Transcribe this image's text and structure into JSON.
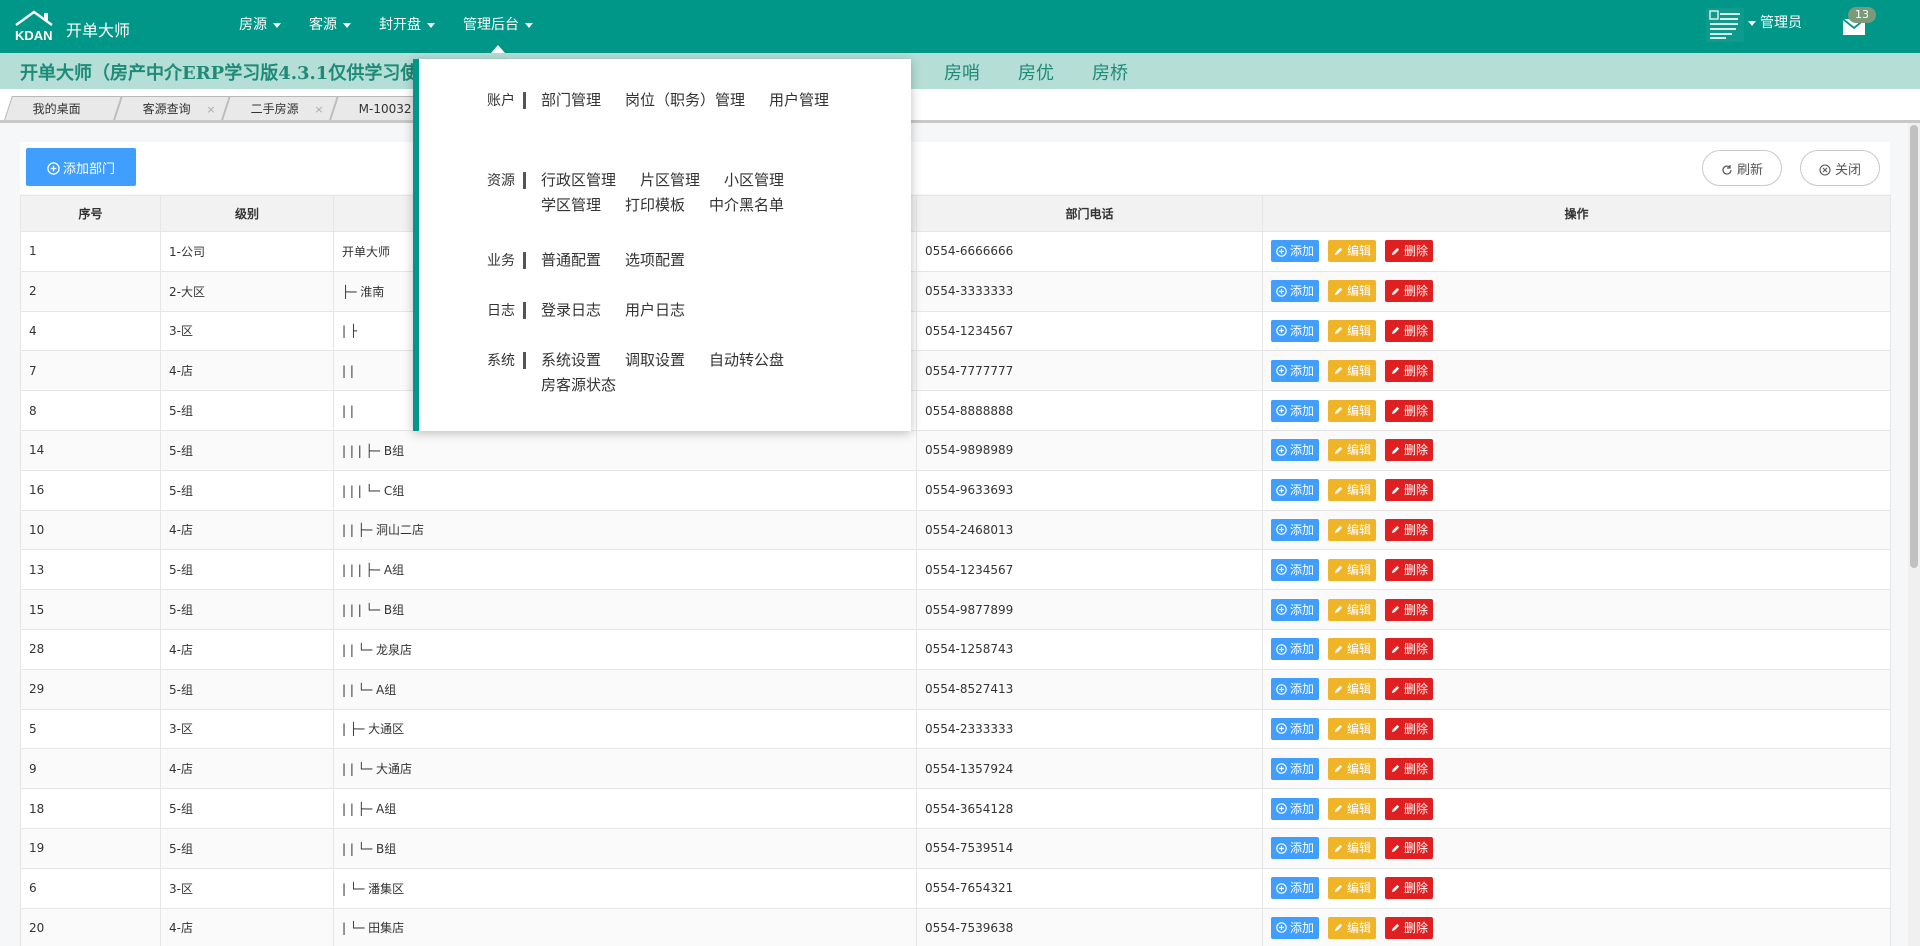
{
  "header": {
    "logo_text": "开单大师",
    "nav": [
      {
        "label": "房源"
      },
      {
        "label": "客源"
      },
      {
        "label": "封开盘"
      },
      {
        "label": "管理后台"
      }
    ],
    "user": "管理员",
    "mail_count": "13"
  },
  "banner": {
    "title": "开单大师（房产中介ERP学习版4.3.1仅供学习使用",
    "links": [
      "房哨",
      "房优",
      "房桥"
    ]
  },
  "tabs": [
    {
      "label": "我的桌面",
      "close": ""
    },
    {
      "label": "客源查询",
      "close": "×"
    },
    {
      "label": "二手房源",
      "close": "×"
    },
    {
      "label": "M-10032",
      "close": ""
    }
  ],
  "toolbar": {
    "add_dept": "添加部门",
    "refresh": "刷新",
    "close": "关闭"
  },
  "table": {
    "columns": [
      "序号",
      "级别",
      "",
      "部门电话",
      "操作"
    ],
    "actions": {
      "add": "添加",
      "edit": "编辑",
      "delete": "删除"
    },
    "rows": [
      {
        "id": "1",
        "level": "1-公司",
        "name": "开单大师",
        "phone": "0554-6666666"
      },
      {
        "id": "2",
        "level": "2-大区",
        "name": "    ├─ 淮南",
        "phone": "0554-3333333"
      },
      {
        "id": "4",
        "level": "3-区",
        "name": "    |     ├",
        "phone": "0554-1234567"
      },
      {
        "id": "7",
        "level": "4-店",
        "name": "    |     |",
        "phone": "0554-7777777"
      },
      {
        "id": "8",
        "level": "5-组",
        "name": "    |     |",
        "phone": "0554-8888888"
      },
      {
        "id": "14",
        "level": "5-组",
        "name": "    |     |      |      ├─ B组",
        "phone": "0554-9898989"
      },
      {
        "id": "16",
        "level": "5-组",
        "name": "    |     |      |      └─ C组",
        "phone": "0554-9633693"
      },
      {
        "id": "10",
        "level": "4-店",
        "name": "    |     |      ├─ 洞山二店",
        "phone": "0554-2468013"
      },
      {
        "id": "13",
        "level": "5-组",
        "name": "    |     |      |      ├─ A组",
        "phone": "0554-1234567"
      },
      {
        "id": "15",
        "level": "5-组",
        "name": "    |     |      |      └─ B组",
        "phone": "0554-9877899"
      },
      {
        "id": "28",
        "level": "4-店",
        "name": "    |     |      └─ 龙泉店",
        "phone": "0554-1258743"
      },
      {
        "id": "29",
        "level": "5-组",
        "name": "    |     |          └─ A组",
        "phone": "0554-8527413"
      },
      {
        "id": "5",
        "level": "3-区",
        "name": "    |     ├─ 大通区",
        "phone": "0554-2333333"
      },
      {
        "id": "9",
        "level": "4-店",
        "name": "    |     |      └─ 大通店",
        "phone": "0554-1357924"
      },
      {
        "id": "18",
        "level": "5-组",
        "name": "    |     |          ├─ A组",
        "phone": "0554-3654128"
      },
      {
        "id": "19",
        "level": "5-组",
        "name": "    |     |          └─ B组",
        "phone": "0554-7539514"
      },
      {
        "id": "6",
        "level": "3-区",
        "name": "    |     └─ 潘集区",
        "phone": "0554-7654321"
      },
      {
        "id": "20",
        "level": "4-店",
        "name": "    |        └─ 田集店",
        "phone": "0554-7539638"
      }
    ]
  },
  "dropdown": {
    "groups": [
      {
        "label": "账户",
        "items": [
          "部门管理",
          "岗位（职务）管理",
          "用户管理"
        ]
      },
      {
        "label": "资源",
        "items": [
          "行政区管理",
          "片区管理",
          "小区管理",
          "学区管理",
          "打印模板",
          "中介黑名单"
        ]
      },
      {
        "label": "业务",
        "items": [
          "普通配置",
          "选项配置"
        ]
      },
      {
        "label": "日志",
        "items": [
          "登录日志",
          "用户日志"
        ]
      },
      {
        "label": "系统",
        "items": [
          "系统设置",
          "调取设置",
          "自动转公盘",
          "房客源状态"
        ]
      }
    ]
  },
  "colors": {
    "primary": "#009688",
    "banner": "#b5ded6",
    "add": "#409eff",
    "edit": "#f0b429",
    "delete": "#e02020"
  }
}
